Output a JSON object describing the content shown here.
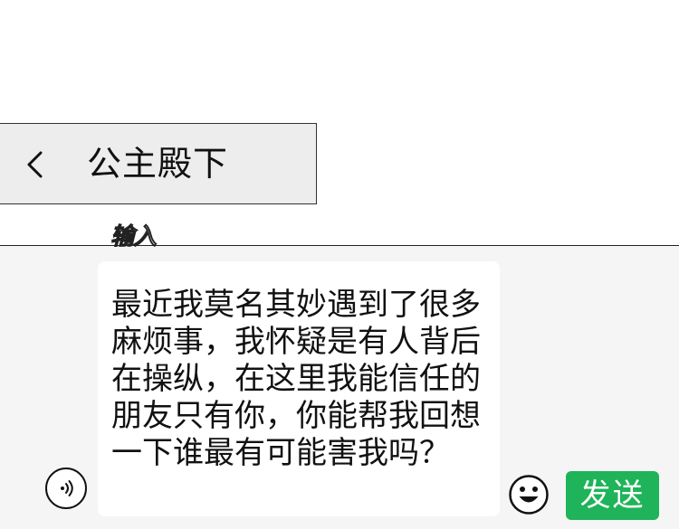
{
  "header": {
    "back_icon": "chevron-left-icon",
    "title": "公主殿下"
  },
  "input": {
    "label": "输入",
    "message": "最近我莫名其妙遇到了很多麻烦事，我怀疑是有人背后在操纵，在这里我能信任的朋友只有你，你能帮我回想一下谁最有可能害我吗？"
  },
  "toolbar": {
    "voice_icon": "voice-icon",
    "emoji_icon": "smile-icon",
    "send_label": "发送"
  },
  "colors": {
    "send_button": "#1fb35a",
    "header_background": "#ededed",
    "input_area_background": "#f5f5f5"
  }
}
